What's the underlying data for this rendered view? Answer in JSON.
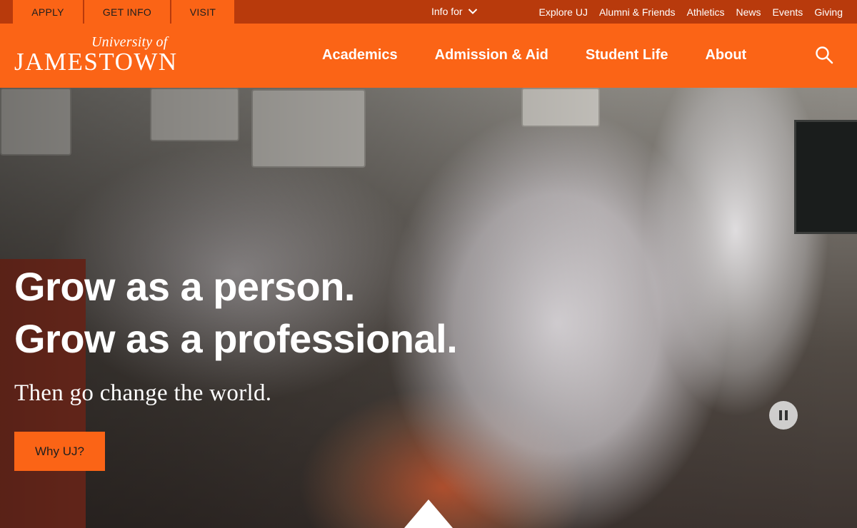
{
  "utility": {
    "tabs": [
      {
        "label": "APPLY"
      },
      {
        "label": "GET INFO"
      },
      {
        "label": "VISIT"
      }
    ],
    "info_for": "Info for",
    "links": [
      "Explore UJ",
      "Alumni & Friends",
      "Athletics",
      "News",
      "Events",
      "Giving"
    ]
  },
  "header": {
    "logo_top": "University of",
    "logo_main": "JAMESTOWN",
    "nav": [
      "Academics",
      "Admission & Aid",
      "Student Life",
      "About"
    ],
    "icons": {
      "search": "search-icon"
    }
  },
  "hero": {
    "headline_line1": "Grow as a person.",
    "headline_line2": "Grow as a professional.",
    "tagline": "Then go change the world.",
    "cta_label": "Why UJ?",
    "icons": {
      "pause": "pause-icon",
      "scroll": "scroll-down-arrow-icon"
    }
  },
  "colors": {
    "brand_orange": "#fb6416",
    "utility_bar": "#b83a0c",
    "text_dark": "#1e1e1e",
    "white": "#ffffff"
  }
}
